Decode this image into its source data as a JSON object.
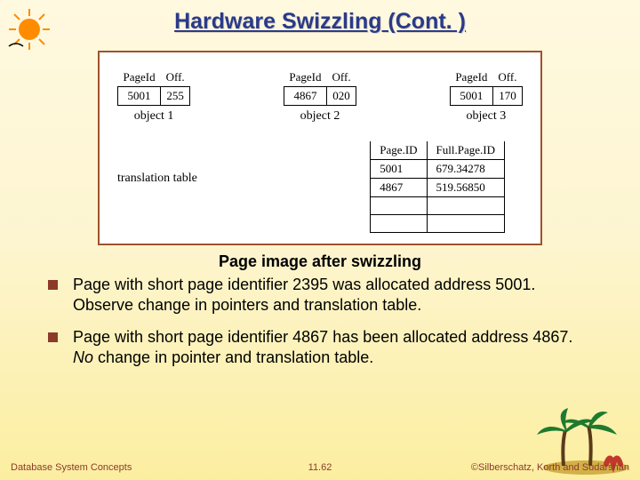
{
  "title": "Hardware Swizzling (Cont. )",
  "figure": {
    "objects": [
      {
        "headers": [
          "PageId",
          "Off."
        ],
        "row": [
          "5001",
          "255"
        ],
        "label": "object 1"
      },
      {
        "headers": [
          "PageId",
          "Off."
        ],
        "row": [
          "4867",
          "020"
        ],
        "label": "object 2"
      },
      {
        "headers": [
          "PageId",
          "Off."
        ],
        "row": [
          "5001",
          "170"
        ],
        "label": "object 3"
      }
    ],
    "trans_label": "translation table",
    "trans_headers": [
      "Page.ID",
      "Full.Page.ID"
    ],
    "trans_rows": [
      [
        "5001",
        "679.34278"
      ],
      [
        "4867",
        "519.56850"
      ],
      [
        "",
        ""
      ],
      [
        "",
        ""
      ]
    ]
  },
  "caption": "Page image after swizzling",
  "bullets": [
    "Page with short page identifier 2395 was allocated address 5001.  Observe change in pointers and translation table.",
    "Page with short page identifier 4867 has been allocated address 4867.  No change in pointer and translation table."
  ],
  "footer": {
    "left": "Database System Concepts",
    "mid": "11.62",
    "right": "©Silberschatz, Korth and Sudarshan"
  }
}
